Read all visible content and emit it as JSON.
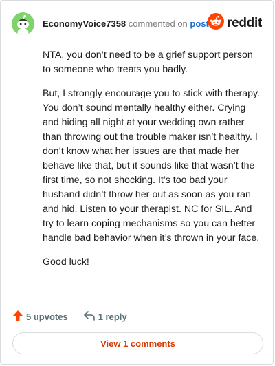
{
  "header": {
    "username": "EconomyVoice7358",
    "commented_text": "commented on",
    "post_link": "post",
    "brand_name": "reddit"
  },
  "comment": {
    "paragraphs": [
      "NTA, you don’t need to be a grief support person to someone who treats you badly.",
      "But, I strongly encourage you to stick with therapy. You don’t sound mentally healthy either. Crying and hiding all night at your wedding own rather than throwing out the trouble maker isn’t healthy. I don’t know what her issues are that made her behave like that, but it sounds like that wasn’t the first time, so not shocking. It’s too bad your husband didn’t throw her out as soon as you ran and hid. Listen to your therapist. NC for SIL. And try to learn coping mechanisms so you can better handle bad behavior when it’s thrown in your face.",
      "Good luck!"
    ]
  },
  "actions": {
    "upvotes_label": "5 upvotes",
    "reply_label": "1 reply"
  },
  "footer": {
    "view_comments_label": "View 1 comments"
  },
  "colors": {
    "accent": "#d93900",
    "upvote": "#ff4500",
    "avatar_bg": "#7ed46a",
    "link": "#1d6fd8"
  },
  "icons": {
    "avatar": "snoo-avatar-icon",
    "brand": "reddit-logo-icon",
    "upvote": "upvote-arrow-icon",
    "reply": "reply-arrow-icon"
  }
}
